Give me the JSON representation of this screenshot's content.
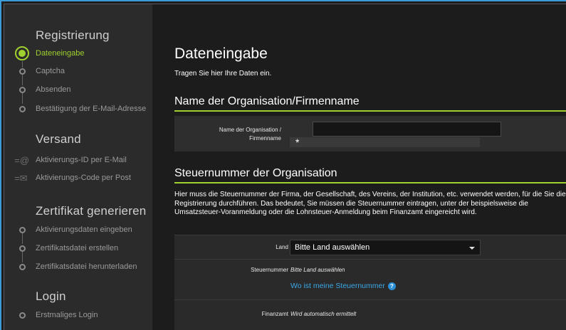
{
  "sidebar": {
    "sections": [
      {
        "title": "Registrierung"
      },
      {
        "title": "Versand"
      },
      {
        "title": "Zertifikat generieren"
      },
      {
        "title": "Login"
      }
    ],
    "items": [
      {
        "label": "Dateneingabe"
      },
      {
        "label": "Captcha"
      },
      {
        "label": "Absenden"
      },
      {
        "label": "Bestätigung der E-Mail-Adresse"
      },
      {
        "label": "Aktivierungs-ID per E-Mail",
        "icon": "@"
      },
      {
        "label": "Aktivierungs-Code per Post",
        "icon": "envelope"
      },
      {
        "label": "Aktivierungsdaten eingeben"
      },
      {
        "label": "Zertifikatsdatei erstellen"
      },
      {
        "label": "Zertifikatsdatei herunterladen"
      },
      {
        "label": "Erstmaliges Login"
      }
    ],
    "active_color": "#9fd02e"
  },
  "main": {
    "title": "Dateneingabe",
    "intro": "Tragen Sie hier Ihre Daten ein.",
    "org_section": {
      "heading": "Name der Organisation/Firmenname",
      "field_label_line1": "Name der Organisation /",
      "field_label_line2": "Firmenname",
      "value": "",
      "required_mark": "*"
    },
    "tax_section": {
      "heading": "Steuernummer der Organisation",
      "description": "Hier muss die Steuernummer der Firma, der Gesellschaft, des Vereins, der Institution, etc. verwendet werden, für die Sie die Registrierung durchführen. Das bedeutet, Sie müssen die Steuernummer eintragen, unter der beispielsweise die Umsatzsteuer-Voranmeldung oder die Lohnsteuer-Anmeldung beim Finanzamt eingereicht wird.",
      "land_label": "Land",
      "land_selected": "Bitte Land auswählen",
      "steuernummer_label": "Steuernummer",
      "steuernummer_hint": "Bitte Land auswählen",
      "help_link": "Wo ist meine Steuernummer",
      "help_icon": "?",
      "finanzamt_label": "Finanzamt",
      "finanzamt_value": "Wird automatisch ermittelt"
    },
    "accent_color": "#9fd02e",
    "link_color": "#3aa8e8"
  }
}
